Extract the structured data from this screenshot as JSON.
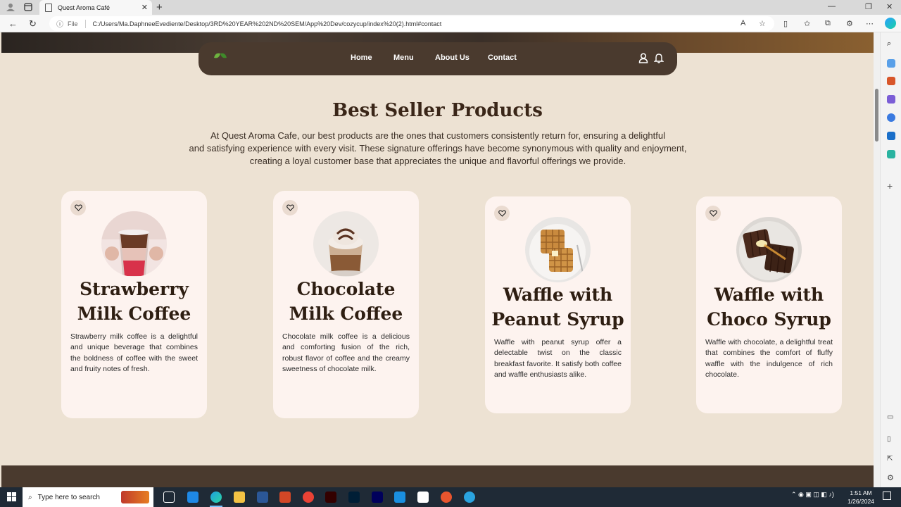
{
  "browser": {
    "tab_title": "Quest Aroma Café",
    "url_prefix": "File",
    "url": "C:/Users/Ma.DaphneeEvediente/Desktop/3RD%20YEAR%202ND%20SEM/App%20Dev/cozycup/index%20(2).html#contact"
  },
  "nav": {
    "links": [
      "Home",
      "Menu",
      "About Us",
      "Contact"
    ]
  },
  "section": {
    "title": "Best Seller Products",
    "description_lines": [
      "At Quest Aroma Cafe, our best products are the ones that customers consistently return for, ensuring a delightful",
      "and satisfying experience with every visit. These signature offerings have become synonymous with quality and enjoyment,",
      "creating a loyal customer base that appreciates the unique and flavorful offerings we provide."
    ]
  },
  "products": [
    {
      "title_lines": [
        "Strawberry",
        "Milk Coffee"
      ],
      "description": "Strawberry milk coffee is a delightful and unique beverage that combines the boldness of coffee with the sweet and fruity notes of fresh."
    },
    {
      "title_lines": [
        "Chocolate",
        "Milk Coffee"
      ],
      "description": "Chocolate milk coffee is a delicious and comforting fusion of the rich, robust flavor of coffee and the creamy sweetness of chocolate milk."
    },
    {
      "title_lines": [
        "Waffle with",
        "Peanut Syrup"
      ],
      "description": "Waffle with peanut syrup offer a delectable twist on the classic breakfast favorite. It satisfy both coffee and waffle enthusiasts alike."
    },
    {
      "title_lines": [
        "Waffle with",
        "Choco Syrup"
      ],
      "description": "Waffle with chocolate, a delightful treat that combines the comfort of fluffy waffle with the indulgence of rich chocolate."
    }
  ],
  "taskbar": {
    "search_placeholder": "Type here to search",
    "time": "1:51 AM",
    "date": "1/26/2024"
  },
  "colors": {
    "nav_bg": "#4a3a2e",
    "page_bg": "#ede2d3",
    "card_bg": "#fdf3ef",
    "title_color": "#3a2618"
  }
}
